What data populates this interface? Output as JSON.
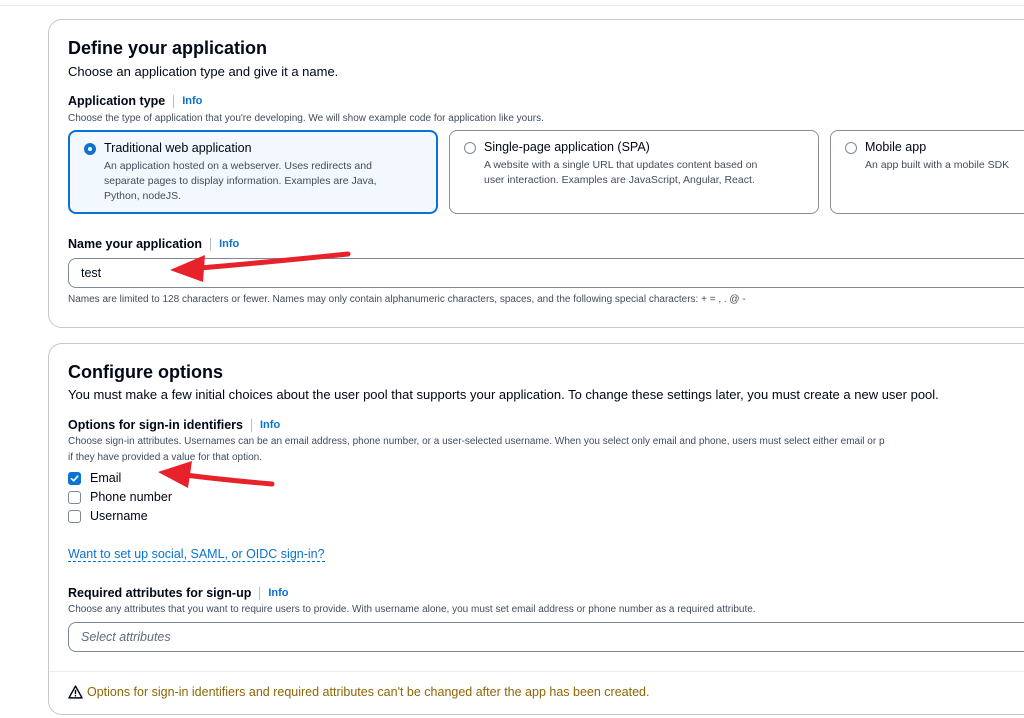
{
  "define": {
    "title": "Define your application",
    "description": "Choose an application type and give it a name.",
    "app_type_label": "Application type",
    "info": "Info",
    "app_type_help": "Choose the type of application that you're developing. We will show example code for application like yours.",
    "tiles": [
      {
        "title": "Traditional web application",
        "desc_lines": [
          "An application hosted on a webserver. Uses redirects and",
          "separate pages to display information. Examples are Java,",
          "Python, nodeJS."
        ],
        "selected": true
      },
      {
        "title": "Single-page application (SPA)",
        "desc_lines": [
          "A website with a single URL that updates content based on",
          "user interaction. Examples are JavaScript, Angular, React."
        ],
        "selected": false
      },
      {
        "title": "Mobile app",
        "desc_lines": [
          "An app built with a mobile SDK"
        ],
        "selected": false
      }
    ],
    "name_label": "Name your application",
    "name_value": "test",
    "name_help": "Names are limited to 128 characters or fewer. Names may only contain alphanumeric characters, spaces, and the following special characters: + = , . @ -"
  },
  "configure": {
    "title": "Configure options",
    "description": "You must make a few initial choices about the user pool that supports your application. To change these settings later, you must create a new user pool.",
    "signin_label": "Options for sign-in identifiers",
    "info": "Info",
    "signin_help_1": "Choose sign-in attributes. Usernames can be an email address, phone number, or a user-selected username. When you select only email and phone, users must select either email or p",
    "signin_help_2": "if they have provided a value for that option.",
    "options": [
      {
        "label": "Email",
        "checked": true
      },
      {
        "label": "Phone number",
        "checked": false
      },
      {
        "label": "Username",
        "checked": false
      }
    ],
    "social_link": "Want to set up social, SAML, or OIDC sign-in?",
    "required_label": "Required attributes for sign-up",
    "required_help": "Choose any attributes that you want to require users to provide. With username alone, you must set email address or phone number as a required attribute.",
    "select_placeholder": "Select attributes",
    "warning": "Options for sign-in identifiers and required attributes can't be changed after the app has been created."
  },
  "colors": {
    "accent": "#0972d3",
    "warning": "#8d6605",
    "annotation_arrow": "#e8222b"
  }
}
